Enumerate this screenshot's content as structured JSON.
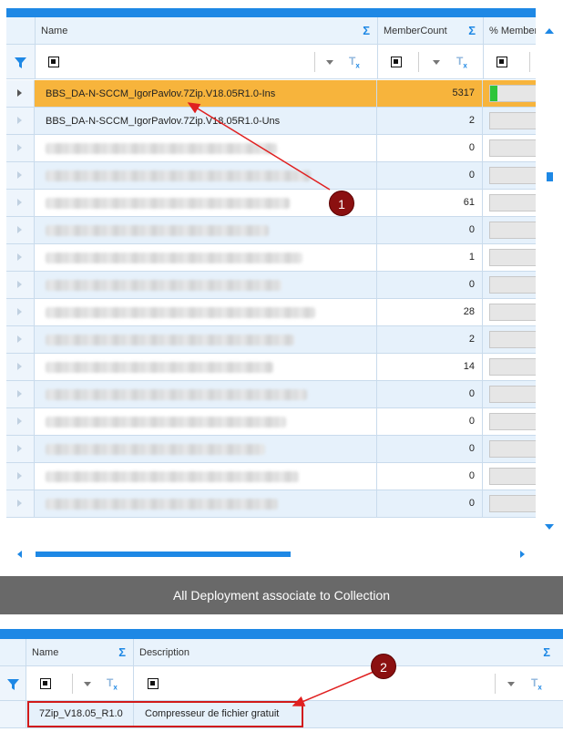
{
  "top_grid": {
    "columns": [
      {
        "label": "Name"
      },
      {
        "label": "MemberCount"
      },
      {
        "label": "% Member"
      }
    ],
    "rows": [
      {
        "name": "BBS_DA-N-SCCM_IgorPavlov.7Zip.V18.05R1.0-Ins",
        "count": "5317",
        "pct": 0.13,
        "selected": true
      },
      {
        "name": "BBS_DA-N-SCCM_IgorPavlov.7Zip.V18.05R1.0-Uns",
        "count": "2",
        "pct": 0
      },
      {
        "name": "",
        "count": "0",
        "pct": 0,
        "blurred": true
      },
      {
        "name": "",
        "count": "0",
        "pct": 0,
        "blurred": true
      },
      {
        "name": "",
        "count": "61",
        "pct": 0,
        "blurred": true
      },
      {
        "name": "",
        "count": "0",
        "pct": 0,
        "blurred": true
      },
      {
        "name": "",
        "count": "1",
        "pct": 0,
        "blurred": true
      },
      {
        "name": "",
        "count": "0",
        "pct": 0,
        "blurred": true
      },
      {
        "name": "",
        "count": "28",
        "pct": 0,
        "blurred": true
      },
      {
        "name": "",
        "count": "2",
        "pct": 0,
        "blurred": true
      },
      {
        "name": "",
        "count": "14",
        "pct": 0,
        "blurred": true
      },
      {
        "name": "",
        "count": "0",
        "pct": 0,
        "blurred": true
      },
      {
        "name": "",
        "count": "0",
        "pct": 0,
        "blurred": true
      },
      {
        "name": "",
        "count": "0",
        "pct": 0,
        "blurred": true
      },
      {
        "name": "",
        "count": "0",
        "pct": 0,
        "blurred": true
      },
      {
        "name": "",
        "count": "0",
        "pct": 0,
        "blurred": true
      }
    ]
  },
  "banner": {
    "title": "All Deployment associate to Collection"
  },
  "bottom_grid": {
    "columns": [
      {
        "label": "Name"
      },
      {
        "label": "Description"
      }
    ],
    "rows": [
      {
        "name": "7Zip_V18.05_R1.0",
        "description": "Compresseur de fichier gratuit"
      }
    ]
  },
  "annotations": [
    {
      "label": "1"
    },
    {
      "label": "2"
    }
  ],
  "icons": {
    "sum": "Σ",
    "filter": "filter-icon",
    "clear_filter": "clear-filter-icon"
  },
  "colors": {
    "accent": "#1e88e5",
    "selected_row": "#f7b43c",
    "annotation": "#8b1010",
    "progress": "#2ec53a"
  }
}
